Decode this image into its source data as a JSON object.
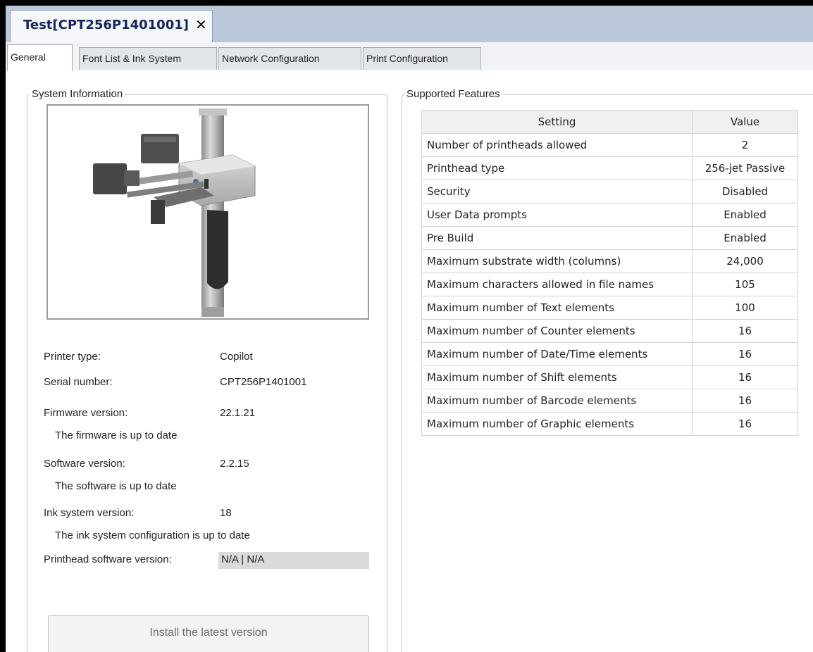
{
  "doc_tab": {
    "title": "Test[CPT256P1401001]",
    "close_glyph": "✕"
  },
  "tabs": [
    {
      "label": "General",
      "active": true
    },
    {
      "label": "Font List & Ink System",
      "active": false
    },
    {
      "label": "Network Configuration",
      "active": false
    },
    {
      "label": "Print Configuration",
      "active": false
    }
  ],
  "system_info": {
    "title": "System Information",
    "image_icon": "printer-image",
    "printer_type": {
      "label": "Printer type:",
      "value": "Copilot"
    },
    "serial_number": {
      "label": "Serial number:",
      "value": "CPT256P1401001"
    },
    "firmware": {
      "label": "Firmware version:",
      "value": "22.1.21",
      "status": "The firmware is up to date"
    },
    "software": {
      "label": "Software version:",
      "value": "2.2.15",
      "status": "The software is up to date"
    },
    "ink_system": {
      "label": "Ink system version:",
      "value": "18",
      "status": "The ink system configuration is up to date"
    },
    "printhead_software": {
      "label": "Printhead software version:",
      "value": "N/A | N/A"
    },
    "install_button": "Install the latest version"
  },
  "features": {
    "title": "Supported Features",
    "columns": [
      "Setting",
      "Value"
    ],
    "rows": [
      {
        "setting": "Number of printheads allowed",
        "value": "2"
      },
      {
        "setting": "Printhead type",
        "value": "256-jet Passive"
      },
      {
        "setting": "Security",
        "value": "Disabled"
      },
      {
        "setting": "User Data prompts",
        "value": "Enabled"
      },
      {
        "setting": "Pre Build",
        "value": "Enabled"
      },
      {
        "setting": "Maximum substrate width (columns)",
        "value": "24,000"
      },
      {
        "setting": "Maximum characters allowed in file names",
        "value": "105"
      },
      {
        "setting": "Maximum number of Text elements",
        "value": "100"
      },
      {
        "setting": "Maximum number of Counter elements",
        "value": "16"
      },
      {
        "setting": "Maximum number of Date/Time elements",
        "value": "16"
      },
      {
        "setting": "Maximum number of Shift elements",
        "value": "16"
      },
      {
        "setting": "Maximum number of Barcode elements",
        "value": "16"
      },
      {
        "setting": "Maximum number of Graphic elements",
        "value": "16"
      }
    ]
  },
  "colors": {
    "tab_bar": "#bac8da",
    "title_text": "#15235c",
    "field_bg": "#dadada"
  }
}
